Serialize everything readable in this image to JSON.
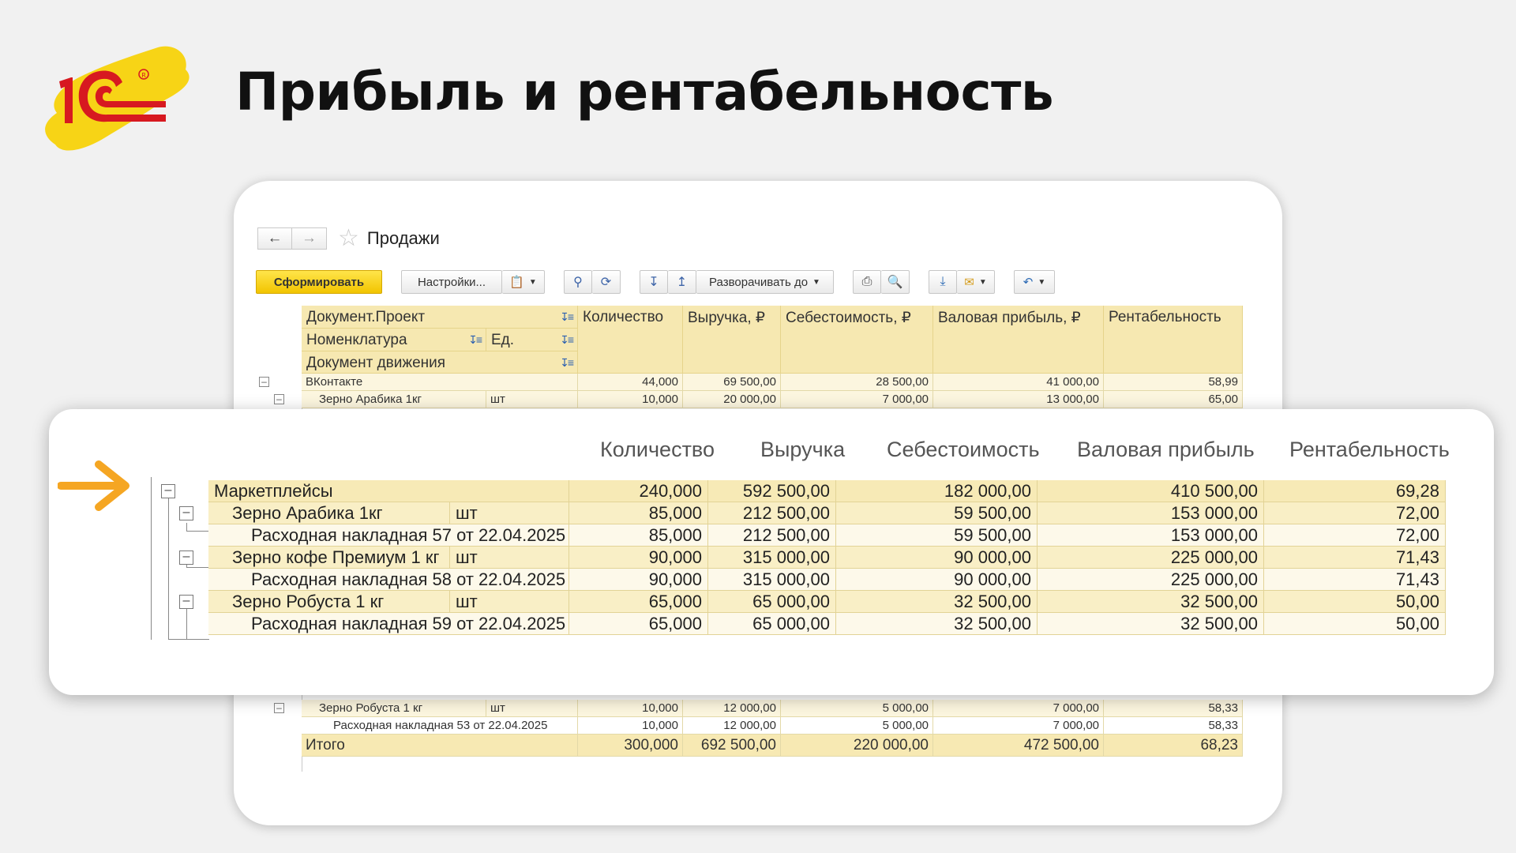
{
  "slide": {
    "title": "Прибыль и рентабельность",
    "brand_color": "#d71920",
    "accent_color": "#f7d416"
  },
  "window": {
    "title": "Продажи",
    "back_icon": "arrow-left-icon",
    "forward_icon": "arrow-right-icon",
    "favorite_icon": "star-icon",
    "toolbar": {
      "generate_label": "Сформировать",
      "settings_label": "Настройки...",
      "expand_label": "Разворачивать до",
      "icons": [
        "variants-icon",
        "search-icon",
        "search-clear-icon",
        "sort-asc-icon",
        "sort-desc-icon",
        "print-icon",
        "print-preview-icon",
        "download-icon",
        "mail-icon",
        "undo-icon"
      ]
    },
    "header": {
      "col1_row1": "Документ.Проект",
      "col1_row2": "Номенклатура",
      "col1_unit": "Ед.",
      "col1_row3": "Документ движения",
      "qty": "Количество",
      "revenue": "Выручка, ₽",
      "cost": "Себестоимость, ₽",
      "profit": "Валовая прибыль, ₽",
      "margin": "Рентабельность"
    },
    "top_rows": [
      {
        "name": "ВКонтакте",
        "unit": "",
        "qty": "44,000",
        "revenue": "69 500,00",
        "cost": "28 500,00",
        "profit": "41 000,00",
        "margin": "58,99"
      },
      {
        "name": "Зерно Арабика 1кг",
        "unit": "шт",
        "qty": "10,000",
        "revenue": "20 000,00",
        "cost": "7 000,00",
        "profit": "13 000,00",
        "margin": "65,00"
      }
    ],
    "bottom_rows": [
      {
        "name": "Зерно Робуста 1 кг",
        "unit": "шт",
        "qty": "10,000",
        "revenue": "12 000,00",
        "cost": "5 000,00",
        "profit": "7 000,00",
        "margin": "58,33"
      },
      {
        "name": "Расходная накладная 53 от 22.04.2025",
        "unit": "",
        "qty": "10,000",
        "revenue": "12 000,00",
        "cost": "5 000,00",
        "profit": "7 000,00",
        "margin": "58,33"
      }
    ],
    "total": {
      "name": "Итого",
      "qty": "300,000",
      "revenue": "692 500,00",
      "cost": "220 000,00",
      "profit": "472 500,00",
      "margin": "68,23"
    }
  },
  "zoom": {
    "headers": {
      "qty": "Количество",
      "revenue": "Выручка",
      "cost": "Себестоимость",
      "profit": "Валовая прибыль",
      "margin": "Рентабельность"
    },
    "rows": [
      {
        "name": "Маркетплейсы",
        "unit": "",
        "qty": "240,000",
        "revenue": "592 500,00",
        "cost": "182 000,00",
        "profit": "410 500,00",
        "margin": "69,28"
      },
      {
        "name": "Зерно Арабика 1кг",
        "unit": "шт",
        "qty": "85,000",
        "revenue": "212 500,00",
        "cost": "59 500,00",
        "profit": "153 000,00",
        "margin": "72,00"
      },
      {
        "name": "Расходная накладная 57 от 22.04.2025",
        "unit": "",
        "qty": "85,000",
        "revenue": "212 500,00",
        "cost": "59 500,00",
        "profit": "153 000,00",
        "margin": "72,00"
      },
      {
        "name": "Зерно кофе Премиум 1 кг",
        "unit": "шт",
        "qty": "90,000",
        "revenue": "315 000,00",
        "cost": "90 000,00",
        "profit": "225 000,00",
        "margin": "71,43"
      },
      {
        "name": "Расходная накладная 58 от 22.04.2025",
        "unit": "",
        "qty": "90,000",
        "revenue": "315 000,00",
        "cost": "90 000,00",
        "profit": "225 000,00",
        "margin": "71,43"
      },
      {
        "name": "Зерно Робуста 1 кг",
        "unit": "шт",
        "qty": "65,000",
        "revenue": "65 000,00",
        "cost": "32 500,00",
        "profit": "32 500,00",
        "margin": "50,00"
      },
      {
        "name": "Расходная накладная 59 от 22.04.2025",
        "unit": "",
        "qty": "65,000",
        "revenue": "65 000,00",
        "cost": "32 500,00",
        "profit": "32 500,00",
        "margin": "50,00"
      }
    ],
    "arrow_color": "#f5a623"
  }
}
